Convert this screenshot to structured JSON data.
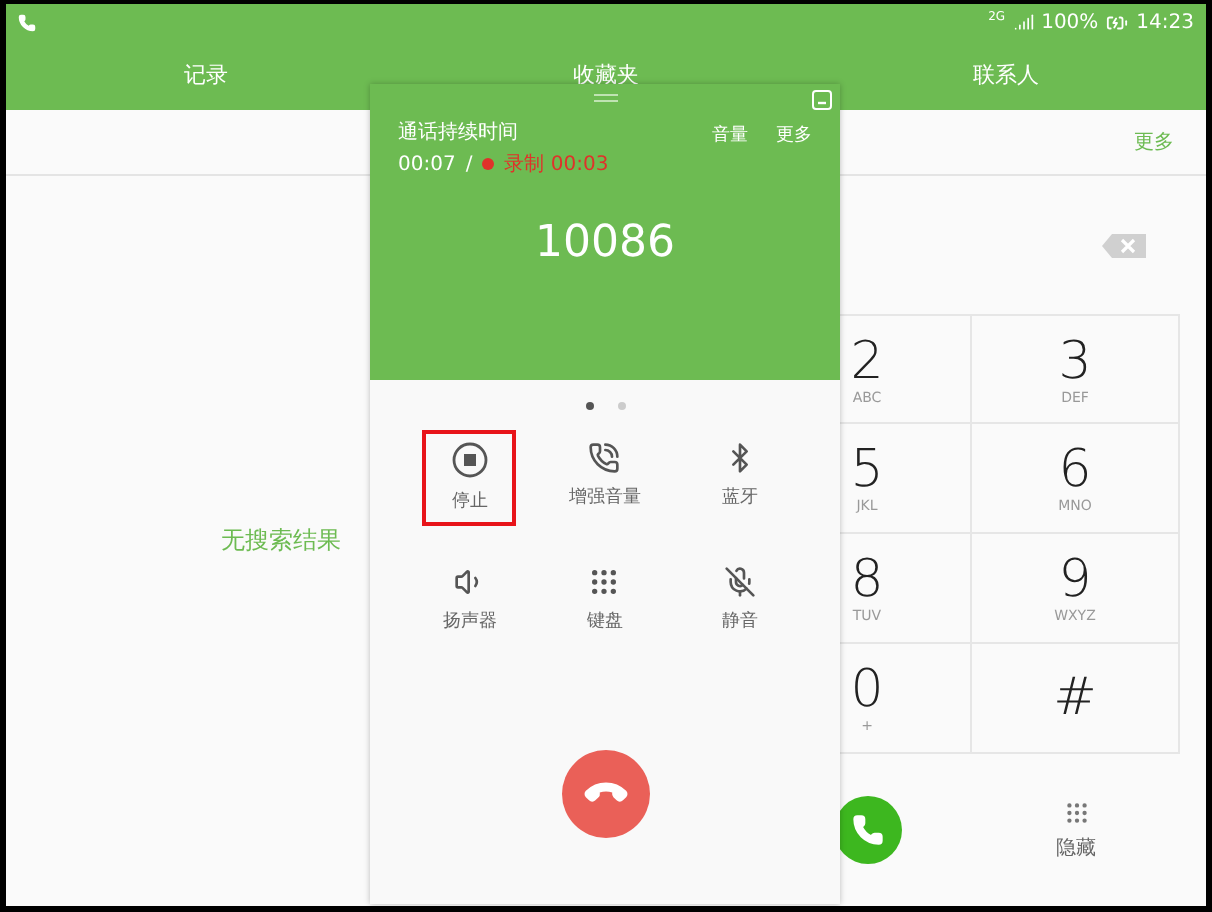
{
  "status_bar": {
    "network": "2G",
    "battery": "100%",
    "time": "14:23"
  },
  "tabs": [
    {
      "label": "记录"
    },
    {
      "label": "收藏夹"
    },
    {
      "label": "联系人"
    }
  ],
  "more": "更多",
  "empty_message": "无搜索结果",
  "keypad": {
    "keys": [
      {
        "digit": "2",
        "letters": "ABC"
      },
      {
        "digit": "3",
        "letters": "DEF"
      },
      {
        "digit": "5",
        "letters": "JKL"
      },
      {
        "digit": "6",
        "letters": "MNO"
      },
      {
        "digit": "8",
        "letters": "TUV"
      },
      {
        "digit": "9",
        "letters": "WXYZ"
      },
      {
        "digit": "0",
        "letters": "+"
      },
      {
        "digit": "#"
      }
    ],
    "hide": "隐藏"
  },
  "call_panel": {
    "duration_label": "通话持续时间",
    "duration": "00:07",
    "separator": "/",
    "recording": "录制 00:03",
    "volume": "音量",
    "more": "更多",
    "number": "10086",
    "page_dots": [
      {
        "selected": true
      },
      {
        "selected": false
      }
    ],
    "controls": [
      {
        "label": "停止",
        "kind": "stop",
        "highlighted": true
      },
      {
        "label": "增强音量",
        "kind": "boost",
        "highlighted": false
      },
      {
        "label": "蓝牙",
        "kind": "bluetooth",
        "highlighted": false
      },
      {
        "label": "扬声器",
        "kind": "speaker",
        "highlighted": false
      },
      {
        "label": "键盘",
        "kind": "keypad",
        "highlighted": false
      },
      {
        "label": "静音",
        "kind": "mute",
        "highlighted": false
      }
    ]
  }
}
